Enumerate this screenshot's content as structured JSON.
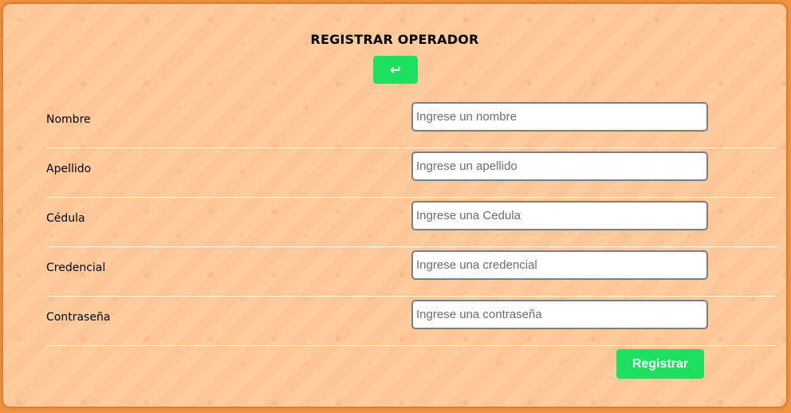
{
  "page": {
    "title": "REGISTRAR OPERADOR",
    "back_icon": "↩"
  },
  "form": {
    "fields": [
      {
        "label": "Nombre",
        "placeholder": "Ingrese un nombre",
        "value": ""
      },
      {
        "label": "Apellido",
        "placeholder": "Ingrese un apellido",
        "value": ""
      },
      {
        "label": "Cédula",
        "placeholder": "Ingrese una Cedula",
        "value": ""
      },
      {
        "label": "Credencial",
        "placeholder": "Ingrese una credencial",
        "value": ""
      },
      {
        "label": "Contraseña",
        "placeholder": "Ingrese una contraseña",
        "value": ""
      }
    ],
    "submit_label": "Registrar"
  },
  "colors": {
    "page_background": "#f5943f",
    "card_background": "#ffcc9e",
    "button_green": "#1ee05f"
  },
  "icons": {
    "back": "return-arrow-icon"
  }
}
